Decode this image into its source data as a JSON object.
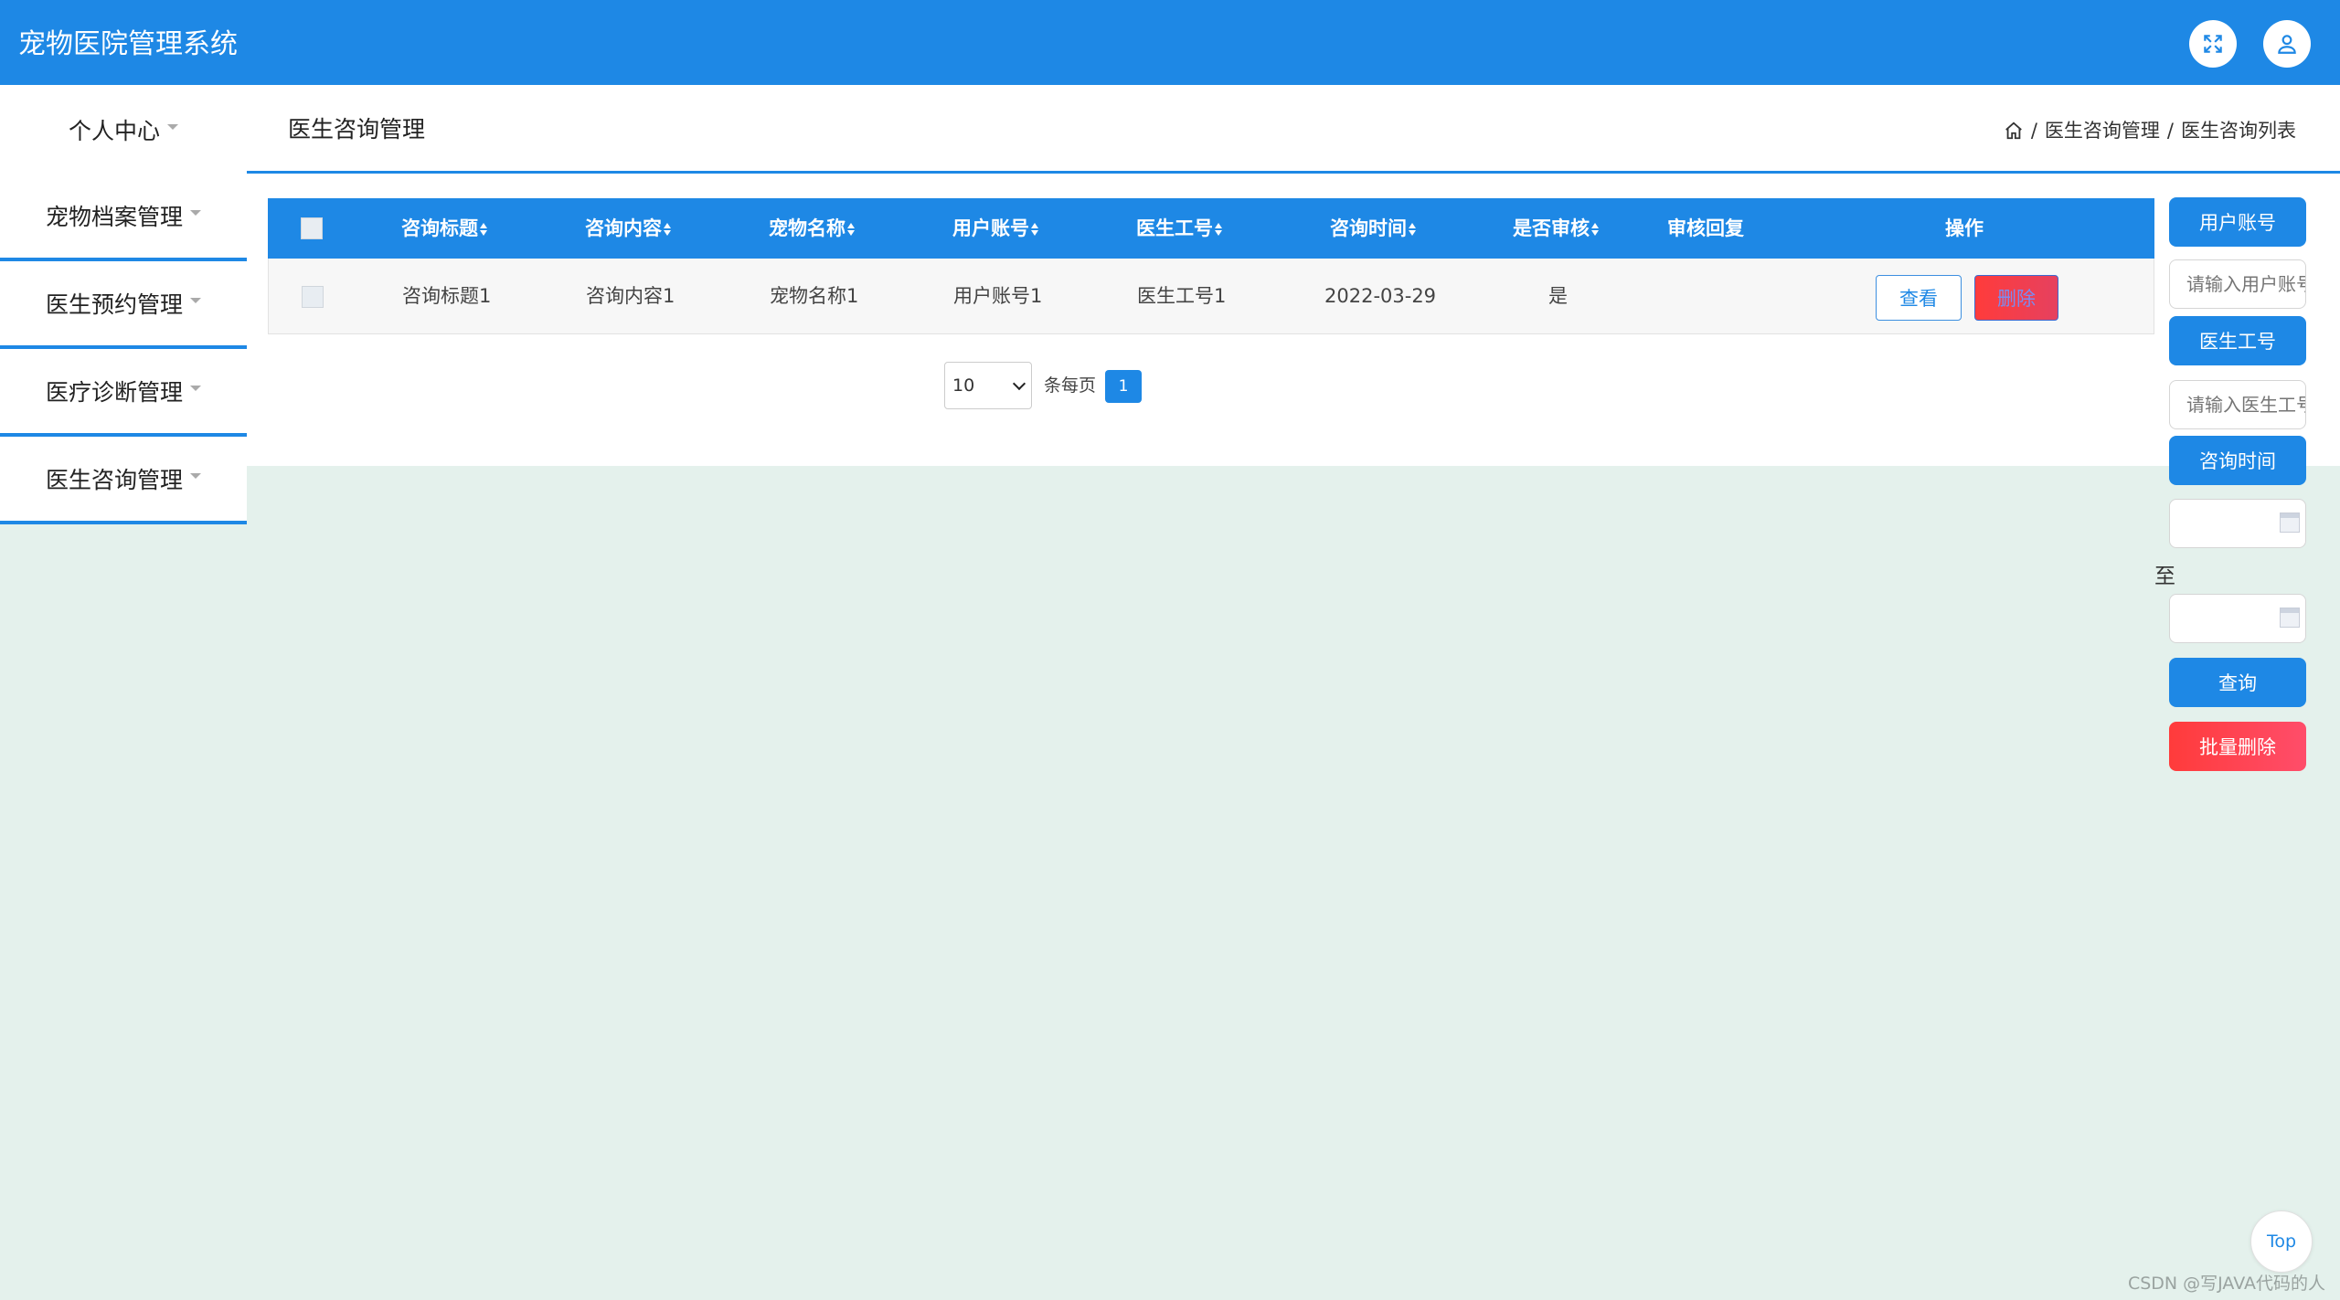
{
  "header": {
    "app_title": "宠物医院管理系统",
    "icons": [
      "fullscreen-icon",
      "user-icon"
    ],
    "colors": {
      "primary": "#1e88e5",
      "danger": "#ff3b3b"
    }
  },
  "subbar": {
    "page_title": "医生咨询管理",
    "breadcrumb": [
      "医生咨询管理",
      "医生咨询列表"
    ],
    "separator": "/"
  },
  "sidebar": {
    "items": [
      {
        "label": "个人中心"
      },
      {
        "label": "宠物档案管理"
      },
      {
        "label": "医生预约管理"
      },
      {
        "label": "医疗诊断管理"
      },
      {
        "label": "医生咨询管理"
      }
    ]
  },
  "table": {
    "columns": [
      "咨询标题",
      "咨询内容",
      "宠物名称",
      "用户账号",
      "医生工号",
      "咨询时间",
      "是否审核",
      "审核回复",
      "操作"
    ],
    "rows": [
      {
        "title": "咨询标题1",
        "content": "咨询内容1",
        "pet_name": "宠物名称1",
        "user_account": "用户账号1",
        "doctor_id": "医生工号1",
        "time": "2022-03-29",
        "reviewed": "是",
        "reply": "",
        "view_label": "查看",
        "delete_label": "删除"
      }
    ]
  },
  "pagination": {
    "page_size": "10",
    "per_page_label": "条每页",
    "current_page": "1"
  },
  "filters": {
    "user_account_label": "用户账号",
    "user_account_placeholder": "请输入用户账号",
    "doctor_id_label": "医生工号",
    "doctor_id_placeholder": "请输入医生工号",
    "time_label": "咨询时间",
    "to_label": "至",
    "search_label": "查询",
    "batch_delete_label": "批量删除"
  },
  "top_button": "Top",
  "watermark": "CSDN @写JAVA代码的人"
}
